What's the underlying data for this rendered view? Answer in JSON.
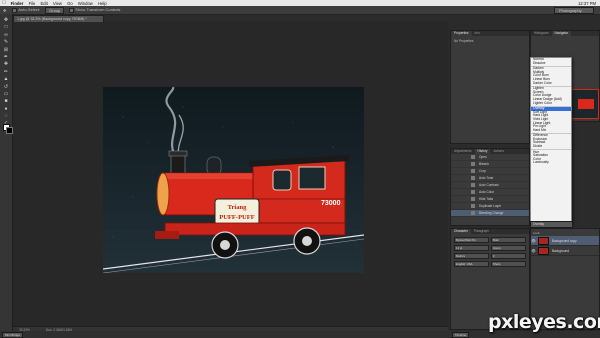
{
  "menubar": {
    "apple": "",
    "items": [
      "Finder",
      "File",
      "Edit",
      "View",
      "Go",
      "Window",
      "Help"
    ],
    "clock": "12:37 PM"
  },
  "options": {
    "auto_select": "Auto-Select:",
    "group": "Group",
    "show_transform": "Show Transform Controls",
    "workspace": "Photography"
  },
  "document": {
    "tab": "1.jpg @ 33.3% (Background copy, RGB/8) *",
    "zoom": "33.33%",
    "doc_size": "Doc: 2.43M/3.18M",
    "badge_line1": "Triang",
    "badge_line2": "PUFF-PUFF",
    "number": "73000"
  },
  "properties": {
    "tabs": [
      "Properties",
      "Info"
    ],
    "subtitle": "No Properties"
  },
  "history": {
    "tabs": [
      "Adjustments",
      "History",
      "Actions"
    ],
    "rows": [
      "Open",
      "Bleach",
      "Crop",
      "Auto Tone",
      "Auto Contrast",
      "Auto Color",
      "Hide Tabs",
      "Duplicate Layer",
      "Blending Change"
    ],
    "active_index": 8
  },
  "character": {
    "tabs": [
      "Character",
      "Paragraph"
    ],
    "font": "Myriad Web Pro",
    "style": "Bold",
    "size": "14 pt",
    "leading": "(Auto)",
    "kerning": "Metrics",
    "tracking": "0",
    "language": "English: USA",
    "aa": "Sharp"
  },
  "navigator": {
    "tabs": [
      "Histogram",
      "Navigator"
    ]
  },
  "layers": {
    "blend_mode": "Overlay",
    "lock_label": "Lock:",
    "items": [
      {
        "name": "Background copy",
        "active": true
      },
      {
        "name": "Background",
        "active": false
      }
    ]
  },
  "blend_groups": [
    [
      "Normal",
      "Dissolve"
    ],
    [
      "Darken",
      "Multiply",
      "Color Burn",
      "Linear Burn",
      "Darker Color"
    ],
    [
      "Lighten",
      "Screen",
      "Color Dodge",
      "Linear Dodge (Add)",
      "Lighter Color"
    ],
    [
      "Overlay",
      "Soft Light",
      "Hard Light",
      "Vivid Light",
      "Linear Light",
      "Pin Light",
      "Hard Mix"
    ],
    [
      "Difference",
      "Exclusion",
      "Subtract",
      "Divide"
    ],
    [
      "Hue",
      "Saturation",
      "Color",
      "Luminosity"
    ]
  ],
  "blend_selected": "Overlay",
  "bottom": {
    "mini_bridge": "Mini Bridge",
    "timeline": "Timeline"
  },
  "watermark": "pxleyes.com",
  "colors": {
    "train_red": "#d8291c",
    "selection_blue": "#3470d8"
  }
}
